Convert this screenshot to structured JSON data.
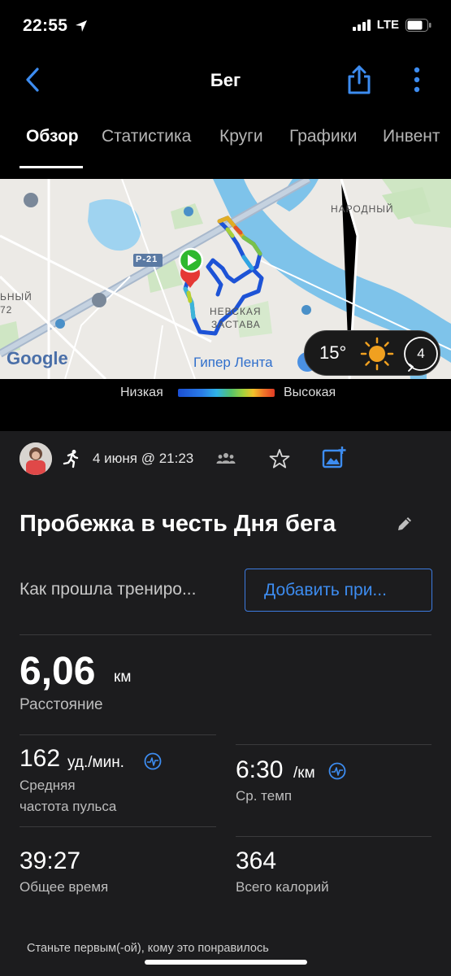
{
  "status": {
    "time": "22:55",
    "network": "LTE",
    "icons": [
      "location-arrow-icon",
      "signal-icon",
      "battery-icon"
    ]
  },
  "header": {
    "title": "Бег",
    "icons": [
      "back-icon",
      "share-icon",
      "more-vertical-icon"
    ]
  },
  "tabs": [
    {
      "label": "Обзор",
      "active": true
    },
    {
      "label": "Статистика"
    },
    {
      "label": "Круги"
    },
    {
      "label": "Графики"
    },
    {
      "label": "Инвент"
    }
  ],
  "map": {
    "labels": {
      "district_east": "НАРОДНЫЙ",
      "district_center_1": "НЕВСКАЯ",
      "district_center_2": "ЗАСТАВА",
      "west_1": "ЬНЫЙ",
      "west_2": "72",
      "road": "Р-21",
      "store": "Гипер Лента",
      "google": "Google"
    },
    "weather": {
      "temperature": "15°",
      "wind_speed": "4",
      "icons": [
        "sun-icon",
        "wind-icon"
      ]
    }
  },
  "legend": {
    "low": "Низкая",
    "high": "Высокая"
  },
  "activity": {
    "date": "4 июня @ 21:23",
    "title": "Пробежка в честь Дня бега",
    "feeling_prompt": "Как прошла трениро...",
    "add_button": "Добавить при...",
    "distance": {
      "value": "6,06",
      "unit": "км",
      "label": "Расстояние"
    },
    "heart_rate": {
      "value": "162",
      "unit": "уд./мин.",
      "label_line1": "Средняя",
      "label_line2": "частота пульса"
    },
    "pace": {
      "value": "6:30",
      "unit": "/км",
      "label": "Ср. темп"
    },
    "time": {
      "value": "39:27",
      "label": "Общее время"
    },
    "calories": {
      "value": "364",
      "label": "Всего калорий"
    },
    "likes_text": "Станьте первым(-ой), кому это понравилось"
  },
  "colors": {
    "accent": "#3d8cf0",
    "panel": "#1c1c1e",
    "start": "#2eb82e",
    "end": "#e53935"
  }
}
